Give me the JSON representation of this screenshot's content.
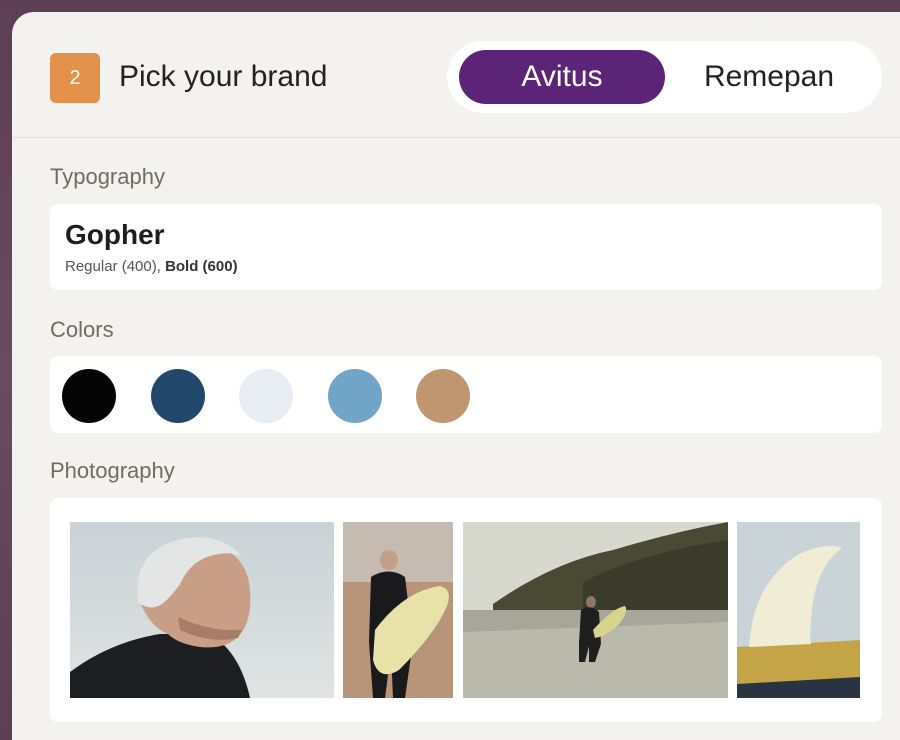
{
  "header": {
    "step_number": "2",
    "title": "Pick your brand",
    "brand_options": [
      {
        "label": "Avitus",
        "active": true
      },
      {
        "label": "Remepan",
        "active": false
      }
    ]
  },
  "typography": {
    "label": "Typography",
    "font_name": "Gopher",
    "weight_regular": "Regular (400), ",
    "weight_bold": "Bold (600)"
  },
  "colors": {
    "label": "Colors",
    "swatches": [
      "#050505",
      "#21476a",
      "#e8edf3",
      "#71a5c7",
      "#c09671"
    ]
  },
  "photography": {
    "label": "Photography",
    "photos": [
      "portrait-photo",
      "surfer-walking-photo",
      "beach-landscape-photo",
      "surfboard-fin-photo"
    ]
  },
  "accent_colors": {
    "step_badge": "#e2904a",
    "active_toggle": "#5c2476"
  }
}
